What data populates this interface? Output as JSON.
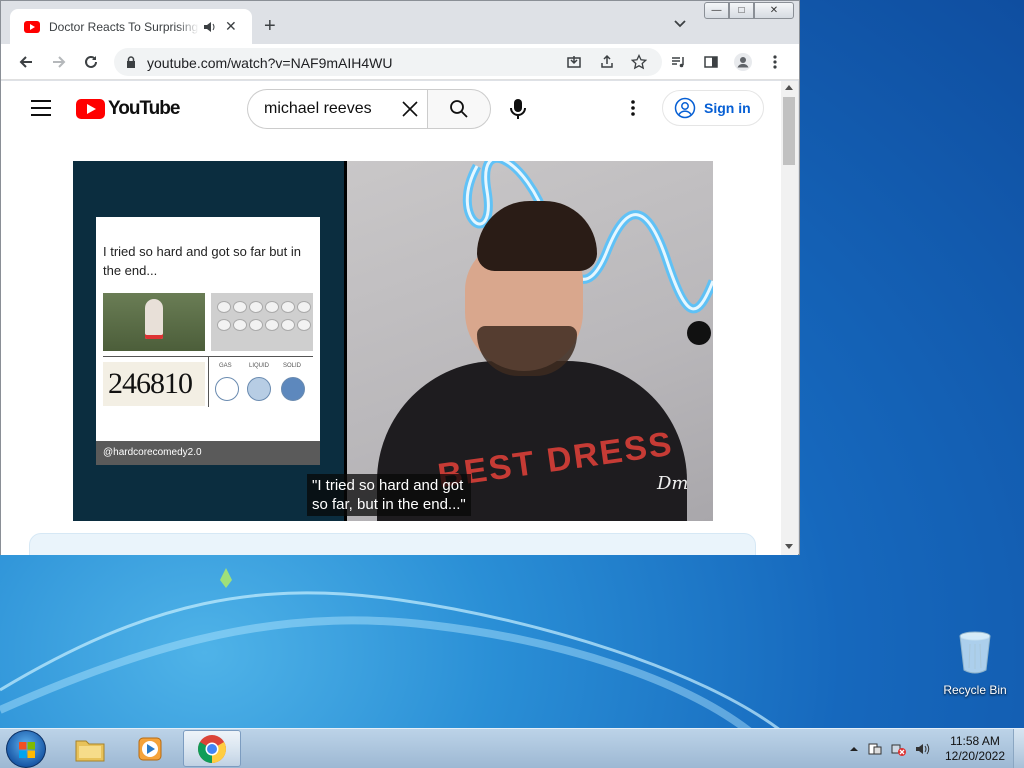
{
  "browser": {
    "tab": {
      "title": "Doctor Reacts To Surprisingly",
      "close_glyph": "✕"
    },
    "new_tab_glyph": "+",
    "url": "youtube.com/watch?v=NAF9mAIH4WU",
    "window_controls": {
      "min": "—",
      "max": "□",
      "close": "✕"
    }
  },
  "youtube": {
    "logo_text": "YouTube",
    "search_query": "michael reeves",
    "sign_in_label": "Sign in"
  },
  "video": {
    "meme_caption": "I tried so hard and got so far but in the end...",
    "meme_numbers": "246810",
    "meme_handle": "@hardcorecomedy2.0",
    "meme_state_labels": [
      "GAS",
      "LIQUID",
      "SOLID"
    ],
    "shirt_text": "BEST DRESS",
    "signature": "Dm",
    "subtitle": "\"I tried so hard and got\nso far, but in the end...\""
  },
  "desktop": {
    "recycle_bin_label": "Recycle Bin"
  },
  "taskbar": {
    "time": "11:58 AM",
    "date": "12/20/2022"
  },
  "colors": {
    "youtube_red": "#ff0000",
    "link_blue": "#065fd4",
    "desktop_blue": "#1668bd"
  }
}
